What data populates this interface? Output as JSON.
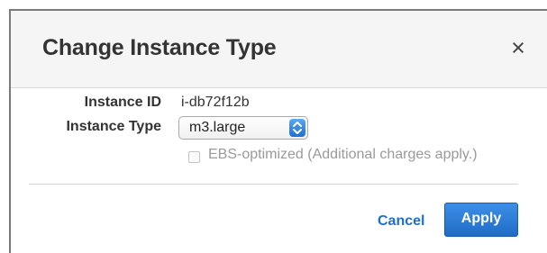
{
  "dialog": {
    "title": "Change Instance Type",
    "close_symbol": "×"
  },
  "form": {
    "instance_id_label": "Instance ID",
    "instance_id_value": "i-db72f12b",
    "instance_type_label": "Instance Type",
    "instance_type_selected": "m3.large",
    "ebs_optimized_label": "EBS-optimized (Additional charges apply.)",
    "ebs_optimized_checked": false
  },
  "actions": {
    "cancel_label": "Cancel",
    "apply_label": "Apply"
  },
  "icons": {
    "close": "close-icon",
    "select_arrows": "chevron-up-down-icon"
  },
  "colors": {
    "accent": "#1f6cc7",
    "link": "#1f6fc6",
    "header_bg": "#f5f5f5",
    "disabled_text": "#9a9a9a"
  }
}
